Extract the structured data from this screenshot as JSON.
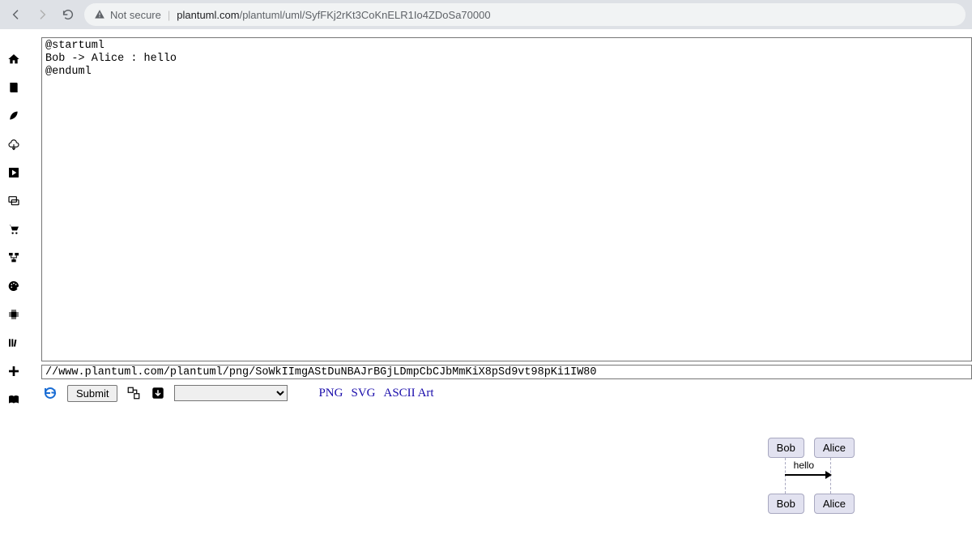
{
  "browser": {
    "security_label": "Not secure",
    "url_host": "plantuml.com",
    "url_path": "/plantuml/uml/SyfFKj2rKt3CoKnELR1Io4ZDoSa70000"
  },
  "editor": {
    "text": "@startuml\nBob -> Alice : hello\n@enduml"
  },
  "url_field": {
    "value": "//www.plantuml.com/plantuml/png/SoWkIImgAStDuNBAJrBGjLDmpCbCJbMmKiX8pSd9vt98pKi1IW80"
  },
  "toolbar": {
    "submit_label": "Submit"
  },
  "links": {
    "png": "PNG",
    "svg": "SVG",
    "ascii": "ASCII Art"
  },
  "diagram": {
    "actor1": "Bob",
    "actor2": "Alice",
    "message": "hello"
  }
}
